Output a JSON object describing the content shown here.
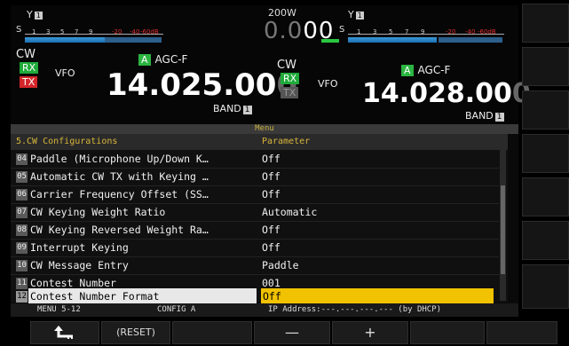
{
  "top": {
    "main": {
      "ant": "Y",
      "ant_num": "1",
      "s_label": "S",
      "scale_nums": [
        "1",
        "3",
        "5",
        "7",
        "9",
        "-20",
        "-40",
        "-60dB"
      ],
      "mode": "CW",
      "rx": "RX",
      "tx": "TX",
      "vfo": "VFO",
      "agc_badge": "A",
      "agc": "AGC-F",
      "freq_bright": "14.025.00",
      "freq_dim": "0",
      "band_label": "BAND",
      "band_num": "1"
    },
    "center": {
      "power": "200W",
      "reading_dim": "0.0",
      "reading_bright": "00"
    },
    "sub": {
      "ant": "Y",
      "ant_num": "1",
      "s_label": "S",
      "scale_nums": [
        "1",
        "3",
        "5",
        "7",
        "9",
        "-20",
        "-40",
        "-60dB"
      ],
      "mode": "CW",
      "rx": "RX",
      "tx": "TX",
      "vfo": "VFO",
      "agc_badge": "A",
      "agc": "AGC-F",
      "freq_bright": "14.028.00",
      "freq_dim": "0",
      "band_label": "BAND",
      "band_num": "1"
    }
  },
  "menu": {
    "title": "Menu",
    "header_item": "5.CW Configurations",
    "header_param": "Parameter",
    "rows": [
      {
        "num": "04",
        "label": "Paddle (Microphone Up/Down K…",
        "value": "Off"
      },
      {
        "num": "05",
        "label": "Automatic CW TX with Keying …",
        "value": "Off"
      },
      {
        "num": "06",
        "label": "Carrier Frequency Offset (SS…",
        "value": "Off"
      },
      {
        "num": "07",
        "label": "CW Keying Weight Ratio",
        "value": "Automatic"
      },
      {
        "num": "08",
        "label": "CW Keying Reversed Weight Ra…",
        "value": "Off"
      },
      {
        "num": "09",
        "label": "Interrupt Keying",
        "value": "Off"
      },
      {
        "num": "10",
        "label": "CW Message Entry",
        "value": "Paddle"
      },
      {
        "num": "11",
        "label": "Contest Number",
        "value": "001"
      },
      {
        "num": "12",
        "label": "Contest Number Format",
        "value": "Off"
      }
    ]
  },
  "status": {
    "menu_pos": "MENU 5-12",
    "config": "CONFIG A",
    "ip": "IP Address:---.---.---.--- (by DHCP)"
  },
  "softkeys": {
    "back_icon": "return-arrow-icon",
    "reset": "(RESET)",
    "minus": "—",
    "plus": "+"
  },
  "colors": {
    "selected_value_bg": "#f0c200",
    "header_text": "#d8b63c",
    "rx_green": "#1faa3a",
    "tx_red": "#d4262a"
  }
}
